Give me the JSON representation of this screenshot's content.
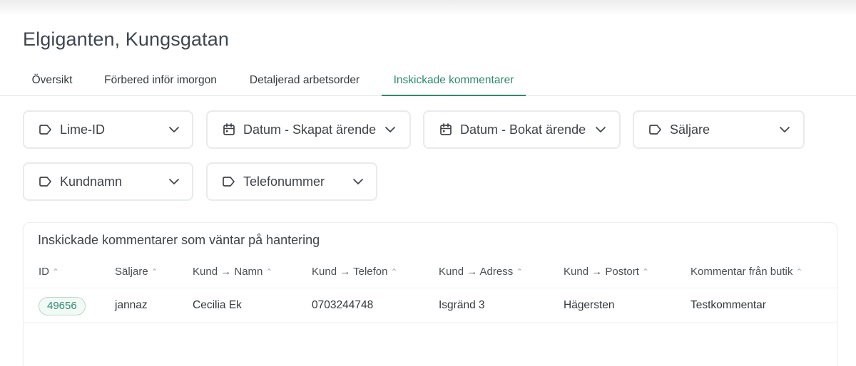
{
  "page": {
    "title": "Elgiganten, Kungsgatan"
  },
  "tabs": [
    {
      "label": "Översikt",
      "active": false
    },
    {
      "label": "Förbered inför imorgon",
      "active": false
    },
    {
      "label": "Detaljerad arbetsorder",
      "active": false
    },
    {
      "label": "Inskickade kommentarer",
      "active": true
    }
  ],
  "filters": [
    {
      "label": "Lime-ID",
      "icon": "tag-icon"
    },
    {
      "label": "Datum - Skapat ärende",
      "icon": "calendar-icon"
    },
    {
      "label": "Datum - Bokat ärende",
      "icon": "calendar-icon"
    },
    {
      "label": "Säljare",
      "icon": "tag-icon"
    },
    {
      "label": "Kundnamn",
      "icon": "tag-icon"
    },
    {
      "label": "Telefonummer",
      "icon": "tag-icon"
    }
  ],
  "table": {
    "title": "Inskickade kommentarer som väntar på hantering",
    "columns": [
      "ID",
      "Säljare",
      "Kund → Namn",
      "Kund → Telefon",
      "Kund → Adress",
      "Kund → Postort",
      "Kommentar från butik"
    ],
    "rows": [
      {
        "id": "49656",
        "saljare": "jannaz",
        "namn": "Cecilia Ek",
        "telefon": "0703244748",
        "adress": "Isgränd 3",
        "postort": "Hägersten",
        "kommentar": "Testkommentar"
      }
    ]
  },
  "colors": {
    "accent": "#2f8a6b",
    "border": "#e8eaec",
    "text": "#3e4248"
  }
}
